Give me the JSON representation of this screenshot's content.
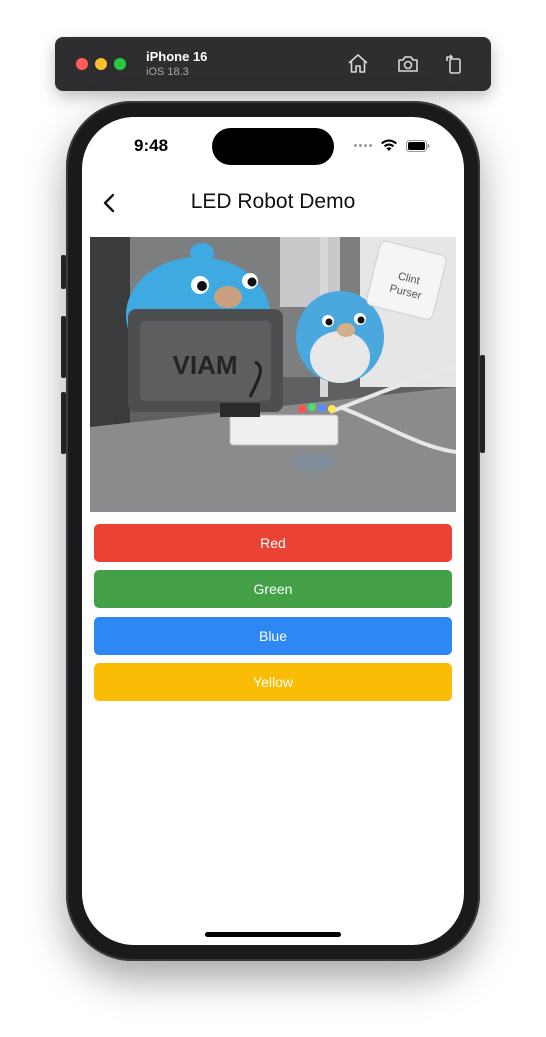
{
  "simulator": {
    "device_name": "iPhone 16",
    "os_version": "iOS 18.3",
    "icons": [
      "home-icon",
      "screenshot-icon",
      "rotate-icon"
    ]
  },
  "status_bar": {
    "time": "9:48",
    "icons": [
      "cellular-signal-icon",
      "wifi-icon",
      "battery-icon"
    ]
  },
  "nav": {
    "title": "LED Robot Demo",
    "back_icon": "chevron-left-icon"
  },
  "camera": {
    "box_label": "VIAM",
    "sticker_line1": "Clint",
    "sticker_line2": "Purser"
  },
  "buttons": [
    {
      "label": "Red",
      "color": "#ea4335"
    },
    {
      "label": "Green",
      "color": "#43a047"
    },
    {
      "label": "Blue",
      "color": "#2d88f3"
    },
    {
      "label": "Yellow",
      "color": "#fbbc05"
    }
  ]
}
